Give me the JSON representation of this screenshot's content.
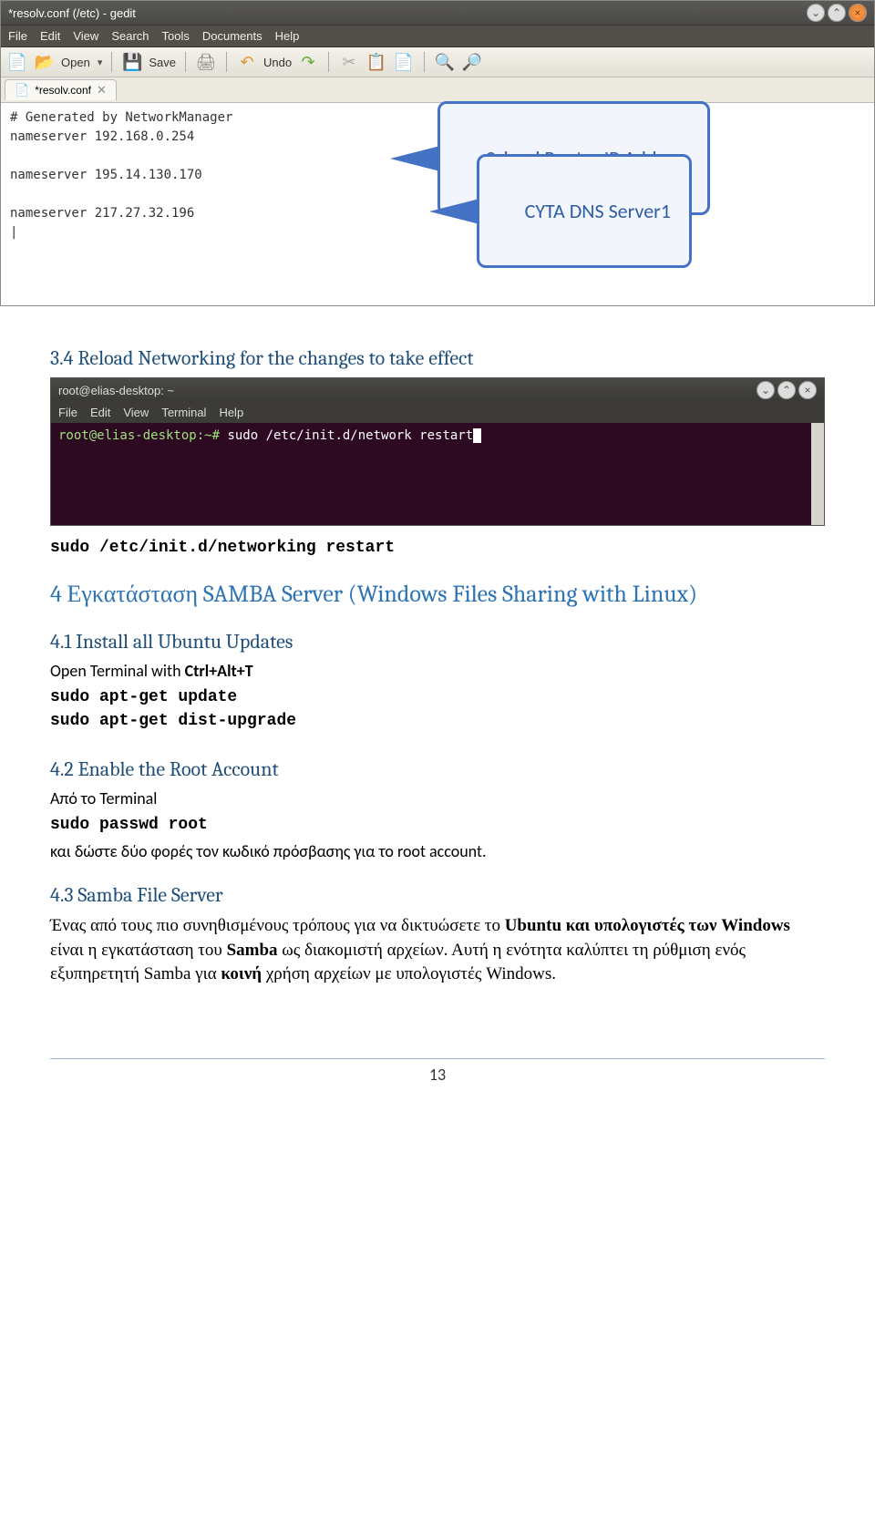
{
  "gedit": {
    "title": "*resolv.conf (/etc) - gedit",
    "menu": [
      "File",
      "Edit",
      "View",
      "Search",
      "Tools",
      "Documents",
      "Help"
    ],
    "toolbar": {
      "open": "Open",
      "save": "Save",
      "undo": "Undo"
    },
    "tab": {
      "label": "*resolv.conf",
      "close": "✕"
    },
    "content": "# Generated by NetworkManager\nnameserver 192.168.0.254\n\nnameserver 195.14.130.170\n\nnameserver 217.27.32.196\n|"
  },
  "callouts": {
    "router": "School Router IP Address",
    "dns": "CYTA DNS Server1"
  },
  "sections": {
    "s34_title": "3.4    Reload Networking for the changes to take effect",
    "cmd_restart": "sudo /etc/init.d/networking restart",
    "s4_title": "4 Εγκατάσταση SAMBA Server (Windows Files Sharing with Linux)",
    "s41_title": "4.1    Install all Ubuntu Updates",
    "s41_text": "Open Terminal with Ctrl+Alt+T",
    "cmd_update": "sudo apt-get update",
    "cmd_upgrade": "sudo apt-get dist-upgrade",
    "s42_title": "4.2    Enable the Root Account",
    "s42_text": "Από το Terminal",
    "cmd_passwd": "sudo passwd root",
    "s42_text2": "και δώστε δύο φορές τον κωδικό πρόσβασης για το root account.",
    "s43_title": "4.3    Samba File Server",
    "s43_para": "Ένας από τους πιο συνηθισμένους τρόπους  για να δικτυώσετε το Ubuntu και υπολογιστές των Windows είναι η εγκατάσταση του Samba ως διακομιστή αρχείων. Αυτή η ενότητα καλύπτει τη ρύθμιση ενός εξυπηρετητή Samba για κοινή χρήση αρχείων με υπολογιστές Windows."
  },
  "terminal": {
    "title": "root@elias-desktop: ~",
    "menu": [
      "File",
      "Edit",
      "View",
      "Terminal",
      "Help"
    ],
    "prompt": "root@elias-desktop:~#",
    "command": " sudo /etc/init.d/network restart"
  },
  "page_number": "13"
}
